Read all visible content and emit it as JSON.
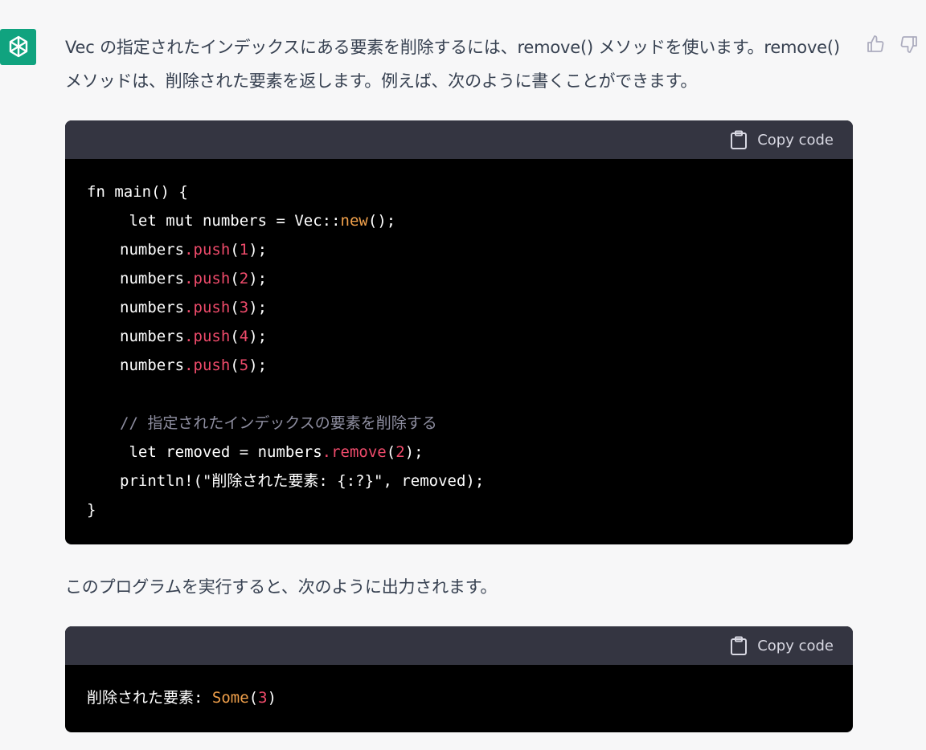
{
  "message": {
    "intro": "Vec の指定されたインデックスにある要素を削除するには、remove() メソッドを使います。remove() メソッドは、削除された要素を返します。例えば、次のように書くことができます。",
    "output_intro": "このプログラムを実行すると、次のように出力されます。"
  },
  "code_blocks": [
    {
      "copy_label": "Copy code",
      "lines": {
        "l1": "fn main() {",
        "l2_a": " let mut numbers = Vec::",
        "l2_b": "new",
        "l2_c": "();",
        "push_obj": "numbers",
        "push_method": ".push",
        "push_open": "(",
        "push_close": ");",
        "v1": "1",
        "v2": "2",
        "v3": "3",
        "v4": "4",
        "v5": "5",
        "comment": "// 指定されたインデックスの要素を削除する",
        "l10_a": " let removed = numbers",
        "l10_b": ".remove",
        "l10_c": "(",
        "l10_d": "2",
        "l10_e": ");",
        "l11": "println!(\"削除された要素: {:?}\", removed);",
        "l12": "}"
      }
    },
    {
      "copy_label": "Copy code",
      "lines": {
        "prefix": "削除された要素: ",
        "some": "Some",
        "open": "(",
        "val": "3",
        "close": ")"
      }
    }
  ],
  "icons": {
    "avatar": "openai-logo-icon",
    "like": "thumbs-up-icon",
    "dislike": "thumbs-down-icon",
    "copy": "clipboard-icon"
  },
  "colors": {
    "avatar_bg": "#10a37f",
    "code_bg": "#000000",
    "code_header_bg": "#343541",
    "method": "#ef4b6b",
    "keyword_new": "#f0a04b",
    "comment": "#8e8ea0"
  }
}
